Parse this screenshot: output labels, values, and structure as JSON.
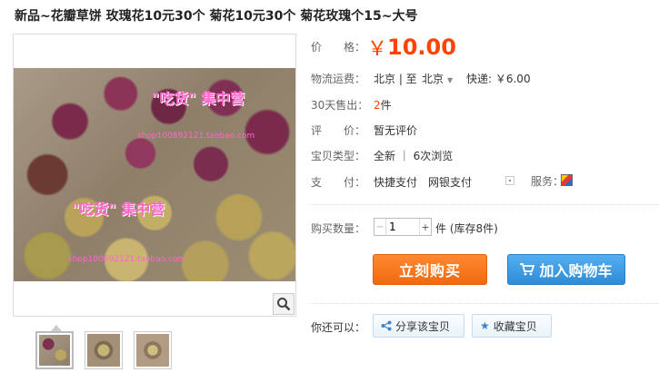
{
  "product": {
    "title": "新品~花瓣草饼 玫瑰花10元30个 菊花10元30个 菊花玫瑰个15~大号"
  },
  "image": {
    "watermark_main_top": "\"吃货\" 集中营",
    "watermark_url_top": "shop100892121.taobao.com",
    "watermark_main_bottom": "\"吃货\" 集中营",
    "watermark_url_bottom": "shop100892121.taobao.com",
    "zoom_icon": "magnifier-icon",
    "thumbnails": [
      "thumb-1",
      "thumb-2",
      "thumb-3"
    ]
  },
  "info": {
    "price_label": "价　　格：",
    "price_symbol": "￥",
    "price_value": "10.00",
    "shipping_label": "物流运费：",
    "shipping_from": "北京 | 至",
    "shipping_to": "北京",
    "shipping_fee": "快递: ￥6.00",
    "sold_label": "30天售出：",
    "sold_value": "2",
    "sold_unit": "件",
    "review_label": "评　　价：",
    "review_value": "暂无评价",
    "type_label": "宝贝类型：",
    "type_value": "全新 ｜ 6次浏览",
    "pay_label": "支　　付：",
    "pay_value": "快捷支付　网银支付",
    "service_label": "服务：",
    "qty_label": "购买数量：",
    "qty_value": "1",
    "qty_unit": "件 (库存8件)",
    "buy_button": "立刻购买",
    "cart_button": "加入购物车",
    "share_prompt": "你还可以：",
    "share_button": "分享该宝贝",
    "fav_button": "收藏宝贝"
  },
  "colors": {
    "price": "#ff4400",
    "buy_button": "#f37a22",
    "cart_button": "#3d9be2"
  }
}
